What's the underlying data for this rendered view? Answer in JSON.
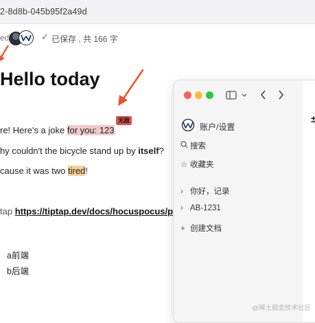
{
  "browser": {
    "url_fragment": "2-8d8b-045b95f2a49d"
  },
  "status_bar": {
    "prefix_tail": "ed",
    "saved_check": "✓",
    "saved_text": "已保存 , 共 166 字"
  },
  "document": {
    "title": "Hello today",
    "line1_prefix": "re! Here's a joke ",
    "line1_highlight": "for you:  123",
    "badge": "无敌",
    "line2_prefix": "hy couldn't the bicycle stand up by ",
    "line2_bold": "itself",
    "line2_suffix": "?",
    "line3_prefix": "cause it was two ",
    "line3_highlight": "tired",
    "line3_suffix": "!",
    "link_prefix": "tap ",
    "link_text": "https://tiptap.dev/docs/hocuspocus/pr",
    "list": [
      "a前端",
      "b后端"
    ]
  },
  "window": {
    "header_label": "账户/设置",
    "items": [
      {
        "icon": "search-icon",
        "label": "搜索"
      },
      {
        "icon": "star-icon",
        "label": "收藏夹"
      },
      {
        "icon": "chevron-right-icon",
        "label": "你好，记录"
      },
      {
        "icon": "chevron-right-icon",
        "label": "AB-1231"
      },
      {
        "icon": "plus-icon",
        "label": "创建文档"
      }
    ],
    "content_glyph": "±"
  },
  "watermark": "@稀土掘金技术社区",
  "colors": {
    "highlight_pink": "#f3c9c9",
    "highlight_orange": "#f6cf96",
    "badge_red": "#d9534f",
    "annotation_arrow": "#f0522c"
  }
}
